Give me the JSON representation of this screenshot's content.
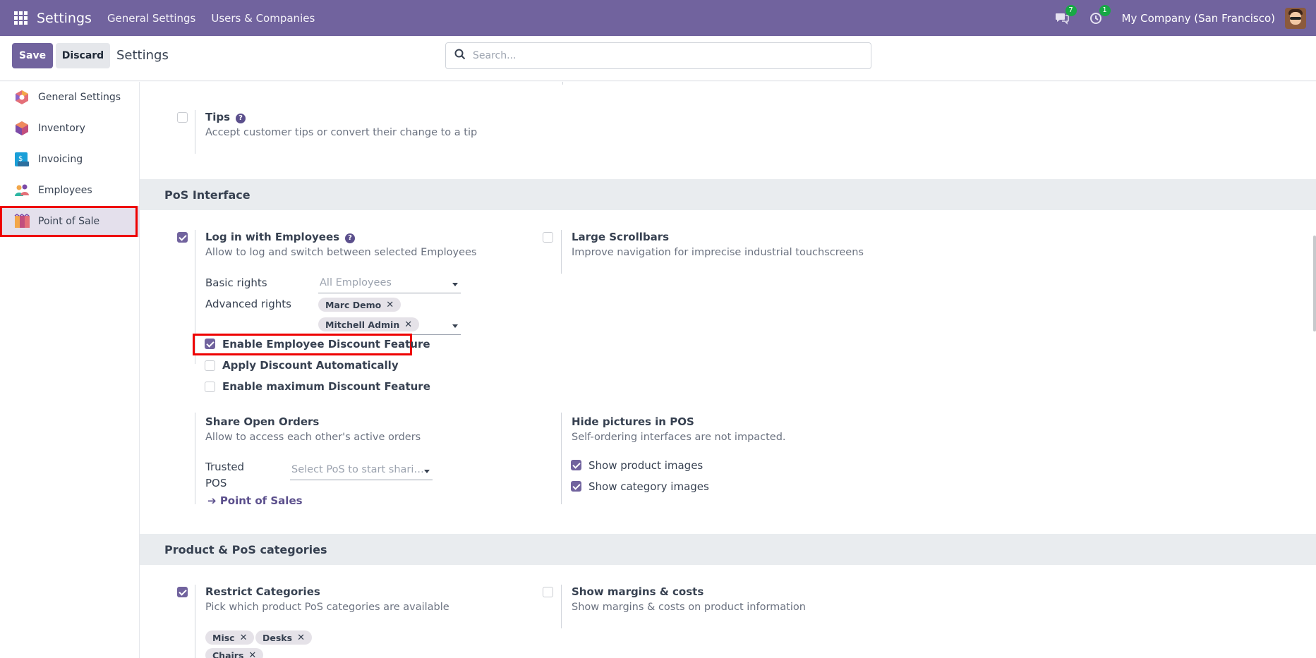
{
  "navbar": {
    "app_title": "Settings",
    "menu": [
      "General Settings",
      "Users & Companies"
    ],
    "messages_badge": "7",
    "activity_badge": "1",
    "company": "My Company (San Francisco)"
  },
  "control_panel": {
    "save_label": "Save",
    "discard_label": "Discard",
    "title": "Settings",
    "search_placeholder": "Search..."
  },
  "sidebar": {
    "items": [
      {
        "label": "General Settings",
        "icon": "general-settings-icon"
      },
      {
        "label": "Inventory",
        "icon": "inventory-icon"
      },
      {
        "label": "Invoicing",
        "icon": "invoicing-icon"
      },
      {
        "label": "Employees",
        "icon": "employees-icon"
      },
      {
        "label": "Point of Sale",
        "icon": "point-of-sale-icon",
        "active": true
      }
    ]
  },
  "settings": {
    "tips": {
      "label": "Tips",
      "desc": "Accept customer tips or convert their change to a tip",
      "checked": false
    },
    "pos_interface": {
      "title": "PoS Interface",
      "login_employees": {
        "label": "Log in with Employees",
        "desc": "Allow to log and switch between selected Employees",
        "checked": true
      },
      "basic_rights_label": "Basic rights",
      "basic_rights_placeholder": "All Employees",
      "advanced_rights_label": "Advanced rights",
      "advanced_rights_tags": [
        "Marc Demo",
        "Mitchell Admin"
      ],
      "enable_discount": {
        "label": "Enable Employee Discount Feature",
        "checked": true
      },
      "apply_discount": {
        "label": "Apply Discount Automatically",
        "checked": false
      },
      "max_discount": {
        "label": "Enable maximum Discount Feature",
        "checked": false
      },
      "large_scrollbars": {
        "label": "Large Scrollbars",
        "desc": "Improve navigation for imprecise industrial touchscreens",
        "checked": false
      },
      "share_orders": {
        "label": "Share Open Orders",
        "desc": "Allow to access each other's active orders"
      },
      "trusted_pos_label_1": "Trusted",
      "trusted_pos_label_2": "POS",
      "trusted_pos_placeholder": "Select PoS to start shari…",
      "point_of_sales_link": "Point of Sales",
      "hide_pictures": {
        "label": "Hide pictures in POS",
        "desc": "Self-ordering interfaces are not impacted."
      },
      "show_product_images": {
        "label": "Show product images",
        "checked": true
      },
      "show_category_images": {
        "label": "Show category images",
        "checked": true
      }
    },
    "product_categories": {
      "title": "Product & PoS categories",
      "restrict": {
        "label": "Restrict Categories",
        "desc": "Pick which product PoS categories are available",
        "checked": true
      },
      "category_tags": [
        "Misc",
        "Desks",
        "Chairs"
      ],
      "margins": {
        "label": "Show margins & costs",
        "desc": "Show margins & costs on product information",
        "checked": false
      }
    }
  },
  "colors": {
    "brand": "#71639e",
    "highlight": "#ee0000",
    "badge": "#17a845"
  }
}
